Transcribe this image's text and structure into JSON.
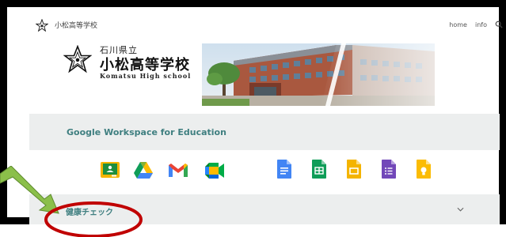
{
  "header": {
    "site_title": "小松高等学校",
    "nav": [
      "home",
      "info"
    ],
    "search_icon": "search-icon"
  },
  "logo": {
    "prefecture": "石川県立",
    "school_name": "小松高等学校",
    "english_name": "Komatsu High school"
  },
  "workspace": {
    "title": "Google Workspace for Education",
    "apps": [
      {
        "name": "google-classroom-icon",
        "color": "#1e8e3e"
      },
      {
        "name": "google-drive-icon",
        "color": "#fbbc04"
      },
      {
        "name": "gmail-icon",
        "color": "#ea4335"
      },
      {
        "name": "google-meet-icon",
        "color": "#00832d"
      },
      {
        "name": "google-docs-icon",
        "color": "#4285f4"
      },
      {
        "name": "google-sheets-icon",
        "color": "#0f9d58"
      },
      {
        "name": "google-slides-icon",
        "color": "#f4b400"
      },
      {
        "name": "google-forms-icon",
        "color": "#7248b9"
      },
      {
        "name": "google-keep-icon",
        "color": "#fbbc04"
      }
    ]
  },
  "health": {
    "label": "健康チェック"
  },
  "annotation": {
    "callout_color": "#c00000",
    "arrow_color": "#8bbf4a"
  }
}
